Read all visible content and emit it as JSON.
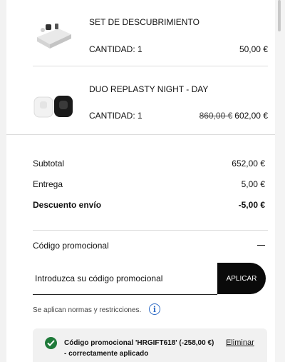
{
  "items": [
    {
      "name": "SET DE DESCUBRIMIENTO",
      "qty": "CANTIDAD: 1",
      "price": "50,00 €",
      "old_price": "",
      "thumb": "discovery-set-image"
    },
    {
      "name": "DUO REPLASTY NIGHT - DAY",
      "qty": "CANTIDAD: 1",
      "price": "602,00 €",
      "old_price": "860,00 €",
      "thumb": "duo-jars-image"
    }
  ],
  "summary": {
    "subtotal_label": "Subtotal",
    "subtotal_value": "652,00 €",
    "delivery_label": "Entrega",
    "delivery_value": "5,00 €",
    "shipping_discount_label": "Descuento envío",
    "shipping_discount_value": "-5,00 €"
  },
  "promo": {
    "heading": "Código promocional",
    "collapse_icon": "minus-icon",
    "input_placeholder": "Introduzca su código promocional",
    "apply_label": "APLICAR",
    "terms": "Se aplican normas y restricciones.",
    "info_icon": "info-icon",
    "applied_message": "Código promocional 'HRGIFT618' (-258,00 €) - correctamente aplicado",
    "remove_label": "Eliminar",
    "success_color": "#1f7a3a",
    "info_color": "#2f6bc5"
  }
}
